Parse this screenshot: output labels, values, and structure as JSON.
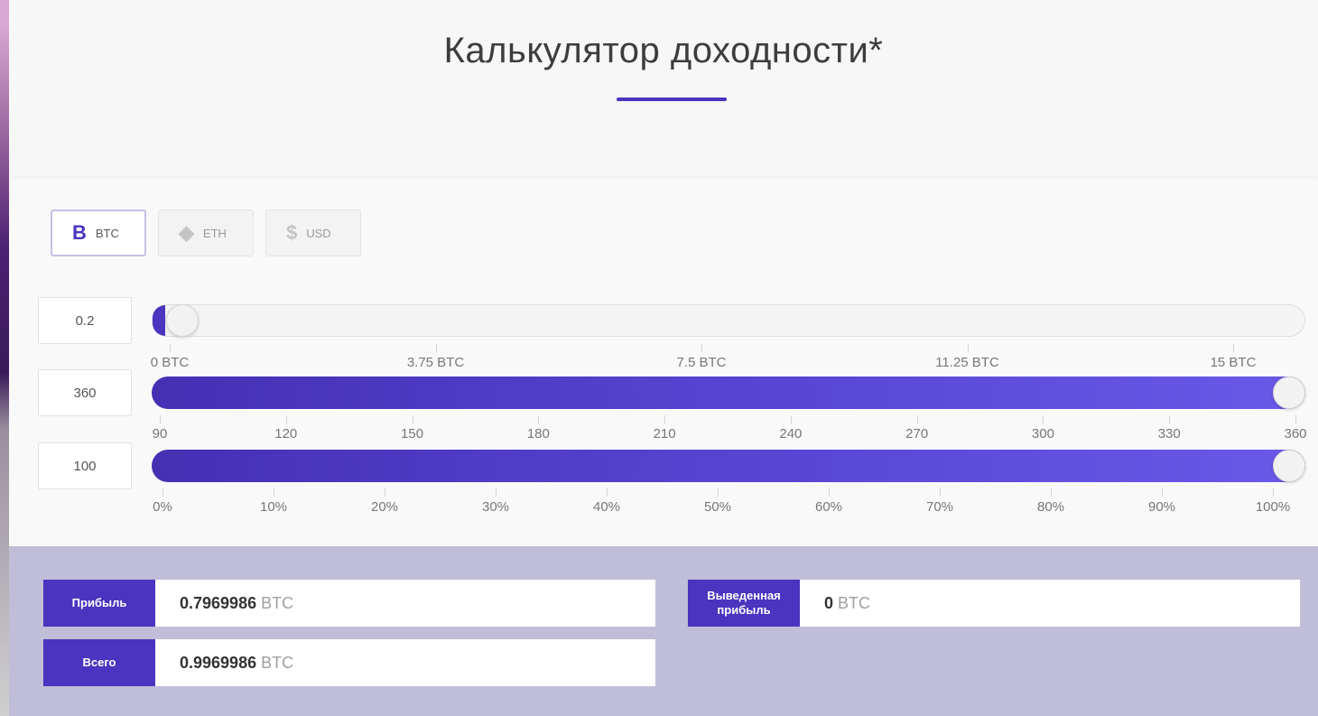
{
  "header": {
    "title": "Калькулятор доходности*"
  },
  "currency_tabs": [
    {
      "label": "BTC",
      "icon": "bitcoin-icon",
      "glyph": "B",
      "active": true
    },
    {
      "label": "ETH",
      "icon": "ethereum-icon",
      "glyph": "◆",
      "active": false
    },
    {
      "label": "USD",
      "icon": "dollar-icon",
      "glyph": "$",
      "active": false
    }
  ],
  "sliders": {
    "amount": {
      "value": "0.2",
      "level": 0.013,
      "ticks": [
        "0 BTC",
        "3.75 BTC",
        "7.5 BTC",
        "11.25 BTC",
        "15 BTC"
      ]
    },
    "days": {
      "value": "360",
      "level": 1.0,
      "ticks": [
        "90",
        "120",
        "150",
        "180",
        "210",
        "240",
        "270",
        "300",
        "330",
        "360"
      ]
    },
    "percent": {
      "value": "100",
      "level": 1.0,
      "ticks": [
        "0%",
        "10%",
        "20%",
        "30%",
        "40%",
        "50%",
        "60%",
        "70%",
        "80%",
        "90%",
        "100%"
      ]
    }
  },
  "results": {
    "profit": {
      "label": "Прибыль",
      "value": "0.7969986",
      "unit": "BTC"
    },
    "total": {
      "label": "Всего",
      "value": "0.9969986",
      "unit": "BTC"
    },
    "withdrawn": {
      "label": "Выведенная прибыль",
      "value": "0",
      "unit": "BTC"
    }
  },
  "colors": {
    "accent": "#4a34c0",
    "results_bg": "#bfbdd7"
  }
}
